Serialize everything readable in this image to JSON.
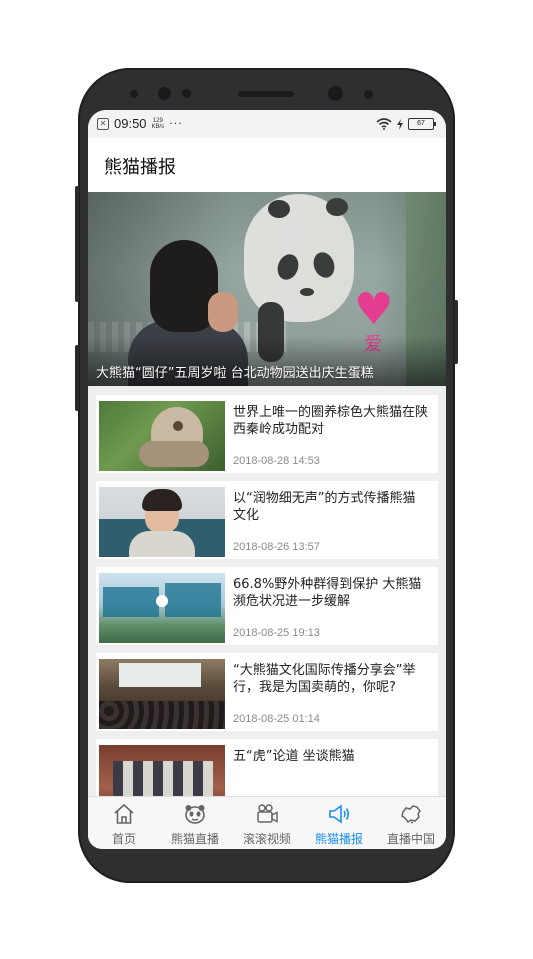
{
  "status_bar": {
    "time": "09:50",
    "speed_value": "129",
    "speed_unit": "KB/s",
    "more": "···",
    "battery": "67"
  },
  "header": {
    "title": "熊猫播报"
  },
  "hero": {
    "caption": "大熊猫“圆仔”五周岁啦 台北动物园送出庆生蛋糕",
    "overlay_text": "爱"
  },
  "news": [
    {
      "title": "世界上唯一的圈养棕色大熊猫在陕西秦岭成功配对",
      "time": "2018-08-28 14:53"
    },
    {
      "title": "以“润物细无声”的方式传播熊猫文化",
      "time": "2018-08-26 13:57"
    },
    {
      "title": "66.8%野外种群得到保护 大熊猫濒危状况进一步缓解",
      "time": "2018-08-25 19:13"
    },
    {
      "title": "“大熊猫文化国际传播分享会”举行，我是为国卖萌的，你呢?",
      "time": "2018-08-25 01:14"
    },
    {
      "title": "五“虎”论道 坐谈熊猫",
      "time": ""
    }
  ],
  "tabs": [
    {
      "label": "首页",
      "icon": "home-icon"
    },
    {
      "label": "熊猫直播",
      "icon": "panda-icon"
    },
    {
      "label": "滚滚视频",
      "icon": "video-camera-icon"
    },
    {
      "label": "熊猫播报",
      "icon": "megaphone-icon",
      "active": true
    },
    {
      "label": "直播中国",
      "icon": "china-map-icon"
    }
  ],
  "colors": {
    "accent": "#1d8ef0",
    "tab_inactive": "#666666",
    "time_text": "#8a8a8a"
  }
}
